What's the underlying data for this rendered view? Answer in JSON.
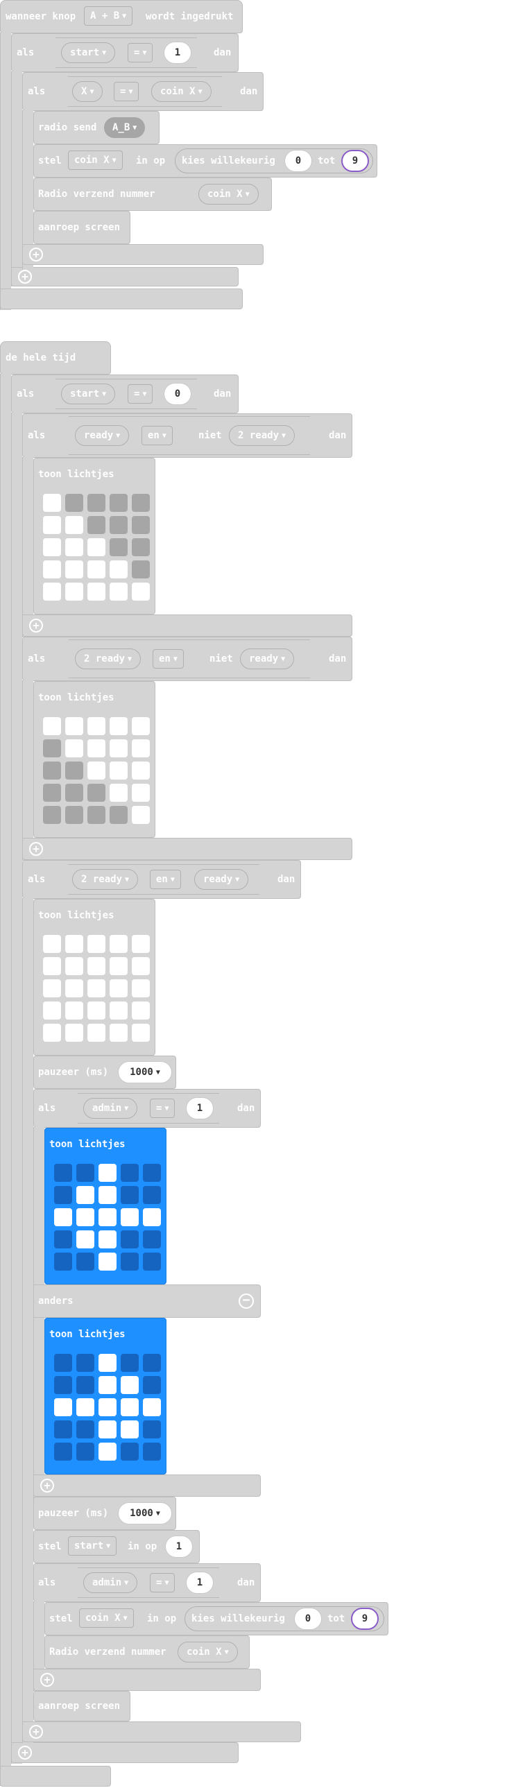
{
  "event1": {
    "label_when": "wanneer knop",
    "button": "A + B",
    "label_pressed": "wordt ingedrukt",
    "if1": {
      "kw": "als",
      "var": "start",
      "op": "=",
      "value": "1",
      "then": "dan"
    },
    "if2": {
      "kw": "als",
      "var": "X",
      "op": "=",
      "rhs": "coin X",
      "then": "dan"
    },
    "radio_send": {
      "label": "radio send",
      "value": "A_B"
    },
    "set1": {
      "kw": "stel",
      "var": "coin X",
      "to": "in op",
      "rand": "kies willekeurig",
      "from": "0",
      "tot": "tot",
      "max": "9"
    },
    "radio_num": {
      "label": "Radio verzend nummer",
      "value": "coin X"
    },
    "call": "aanroep screen"
  },
  "forever": {
    "label": "de hele tijd",
    "if_start": {
      "kw": "als",
      "var": "start",
      "op": "=",
      "value": "0",
      "then": "dan"
    },
    "if_a": {
      "kw": "als",
      "l": "ready",
      "op": "en",
      "not": "niet",
      "r": "2 ready",
      "then": "dan"
    },
    "show_a": {
      "label": "toon lichtjes",
      "leds": [
        [
          1,
          0,
          0,
          0,
          0
        ],
        [
          1,
          1,
          0,
          0,
          0
        ],
        [
          1,
          1,
          1,
          0,
          0
        ],
        [
          1,
          1,
          1,
          1,
          0
        ],
        [
          1,
          1,
          1,
          1,
          1
        ]
      ]
    },
    "if_b": {
      "kw": "als",
      "l": "2 ready",
      "op": "en",
      "not": "niet",
      "r": "ready",
      "then": "dan"
    },
    "show_b": {
      "label": "toon lichtjes",
      "leds": [
        [
          1,
          1,
          1,
          1,
          1
        ],
        [
          0,
          1,
          1,
          1,
          1
        ],
        [
          0,
          0,
          1,
          1,
          1
        ],
        [
          0,
          0,
          0,
          1,
          1
        ],
        [
          0,
          0,
          0,
          0,
          1
        ]
      ]
    },
    "if_c": {
      "kw": "als",
      "l": "2 ready",
      "op": "en",
      "r": "ready",
      "then": "dan"
    },
    "show_c": {
      "label": "toon lichtjes",
      "leds": [
        [
          1,
          1,
          1,
          1,
          1
        ],
        [
          1,
          1,
          1,
          1,
          1
        ],
        [
          1,
          1,
          1,
          1,
          1
        ],
        [
          1,
          1,
          1,
          1,
          1
        ],
        [
          1,
          1,
          1,
          1,
          1
        ]
      ]
    },
    "pause1": {
      "label": "pauzeer (ms)",
      "value": "1000"
    },
    "if_admin": {
      "kw": "als",
      "var": "admin",
      "op": "=",
      "value": "1",
      "then": "dan"
    },
    "show_d": {
      "label": "toon lichtjes",
      "leds": [
        [
          0,
          0,
          1,
          0,
          0
        ],
        [
          0,
          1,
          1,
          0,
          0
        ],
        [
          1,
          1,
          1,
          1,
          1
        ],
        [
          0,
          1,
          1,
          0,
          0
        ],
        [
          0,
          0,
          1,
          0,
          0
        ]
      ]
    },
    "else": "anders",
    "show_e": {
      "label": "toon lichtjes",
      "leds": [
        [
          0,
          0,
          1,
          0,
          0
        ],
        [
          0,
          0,
          1,
          1,
          0
        ],
        [
          1,
          1,
          1,
          1,
          1
        ],
        [
          0,
          0,
          1,
          1,
          0
        ],
        [
          0,
          0,
          1,
          0,
          0
        ]
      ]
    },
    "pause2": {
      "label": "pauzeer (ms)",
      "value": "1000"
    },
    "set_start": {
      "kw": "stel",
      "var": "start",
      "to": "in op",
      "value": "1"
    },
    "if_admin2": {
      "kw": "als",
      "var": "admin",
      "op": "=",
      "value": "1",
      "then": "dan"
    },
    "set2": {
      "kw": "stel",
      "var": "coin X",
      "to": "in op",
      "rand": "kies willekeurig",
      "from": "0",
      "tot": "tot",
      "max": "9"
    },
    "radio_num": {
      "label": "Radio verzend nummer",
      "value": "coin X"
    },
    "call": "aanroep screen"
  },
  "icons": {
    "add": "plus-icon",
    "remove": "minus-icon",
    "dropdown": "caret-down-icon"
  },
  "colors": {
    "block": "#d4d4d4",
    "led_block": "#1e90ff",
    "led_on": "#ffffff",
    "led_off_grey": "#a6a6a6",
    "led_off_blue": "#1565c0"
  }
}
